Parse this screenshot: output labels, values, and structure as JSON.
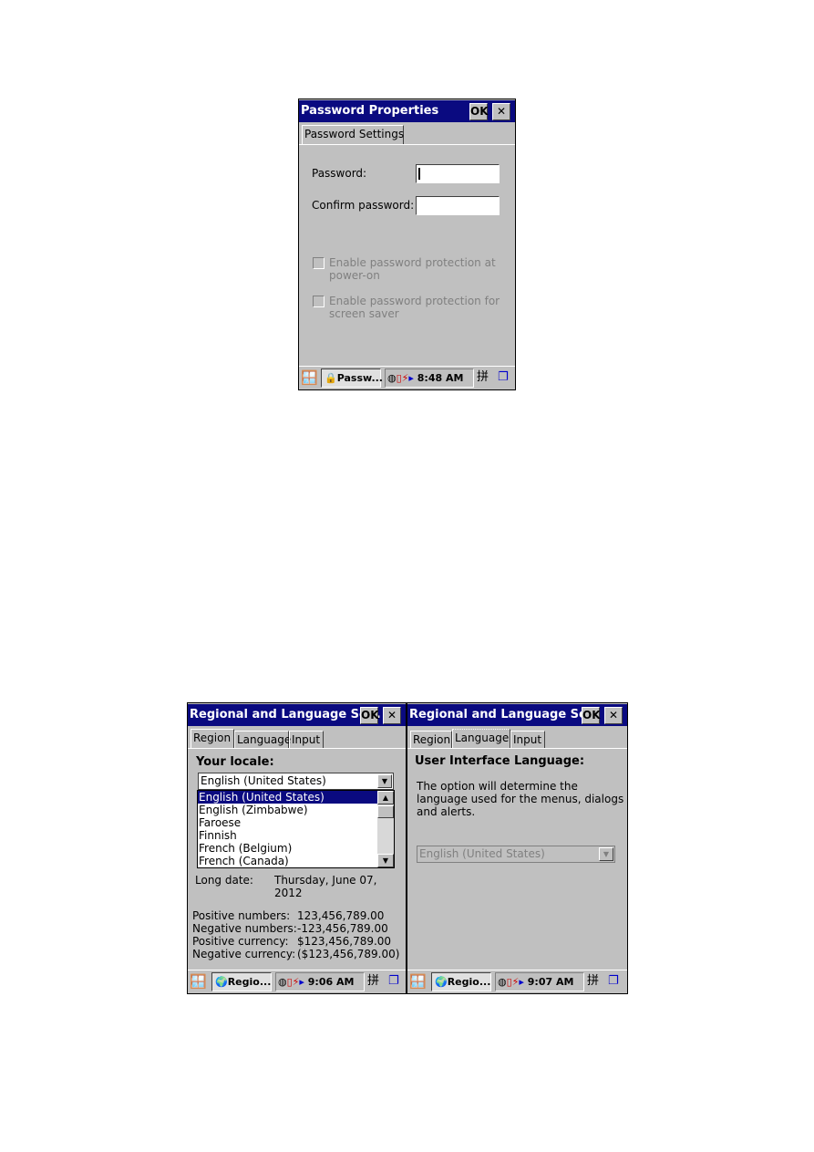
{
  "password_window": {
    "title": "Password Properties",
    "ok": "OK",
    "close": "✕",
    "tab": "Password Settings",
    "password_label": "Password:",
    "password_value": "",
    "confirm_label": "Confirm password:",
    "confirm_value": "",
    "checkbox1_line1": "Enable password protection at",
    "checkbox1_line2": "power-on",
    "checkbox2_line1": "Enable password protection for",
    "checkbox2_line2": "screen saver",
    "taskbar": {
      "app": "Passw...",
      "time": "8:48 AM",
      "ime": "拼"
    }
  },
  "region_window": {
    "title": "Regional and Language Se...",
    "ok": "OK",
    "close": "✕",
    "tabs": [
      "Region",
      "Language",
      "Input"
    ],
    "locale_label": "Your locale:",
    "locale_value": "English (United States)",
    "locale_options": [
      "English (United States)",
      "English (Zimbabwe)",
      "Faroese",
      "Finnish",
      "French (Belgium)",
      "French (Canada)"
    ],
    "long_date_label": "Long date:",
    "long_date_line1": "Thursday, June 07,",
    "long_date_line2": "2012",
    "rows": [
      {
        "label": "Positive numbers:",
        "value": "123,456,789.00"
      },
      {
        "label": "Negative numbers:",
        "value": "-123,456,789.00"
      },
      {
        "label": "Positive currency:",
        "value": "$123,456,789.00"
      },
      {
        "label": "Negative currency:",
        "value": "($123,456,789.00)"
      }
    ],
    "taskbar": {
      "app": "Regio...",
      "time": "9:06 AM",
      "ime": "拼"
    }
  },
  "language_window": {
    "title": "Regional and Language Se...",
    "ok": "OK",
    "close": "✕",
    "tabs": [
      "Region",
      "Language",
      "Input"
    ],
    "heading": "User Interface Language:",
    "desc1": "The option will determine the",
    "desc2": "language used for the menus, dialogs",
    "desc3": "and alerts.",
    "ui_language": "English (United States)",
    "taskbar": {
      "app": "Regio...",
      "time": "9:07 AM",
      "ime": "拼"
    }
  },
  "colors": {
    "titlebar": "#0a0a80",
    "face": "#c0c0c0",
    "selection": "#0a0a80"
  }
}
